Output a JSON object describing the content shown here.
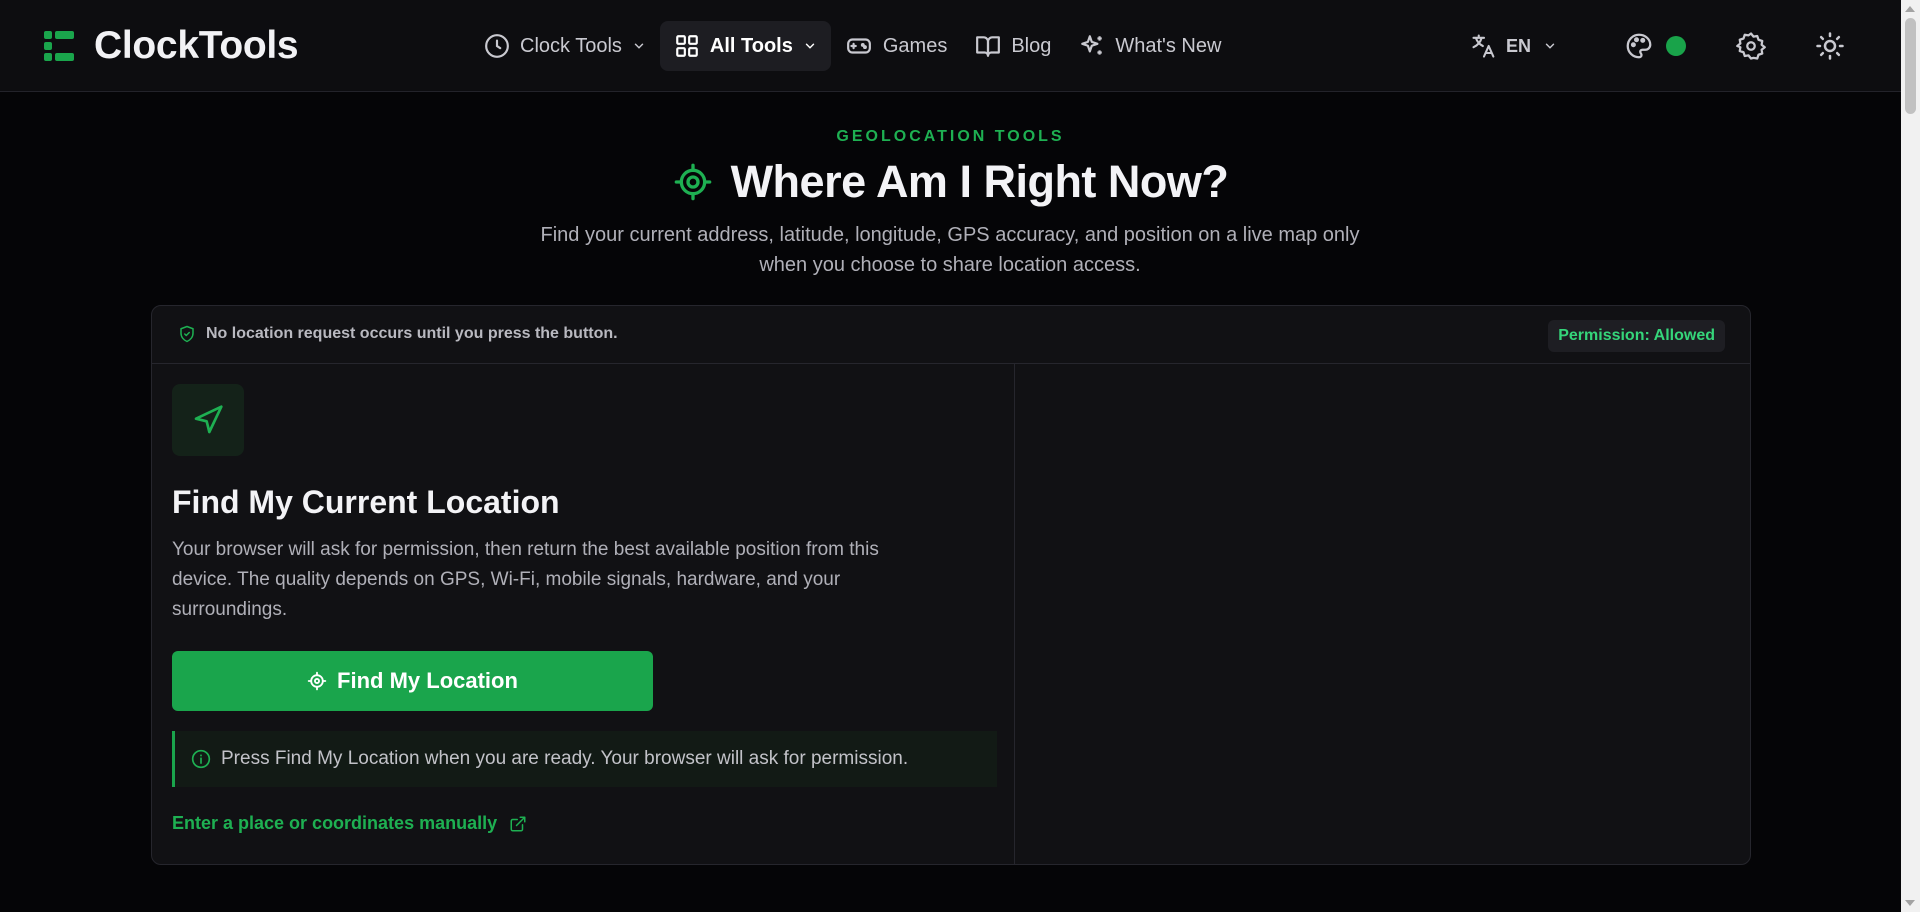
{
  "header": {
    "brand": "ClockTools",
    "nav": [
      {
        "label": "Clock Tools",
        "icon": "clock-icon",
        "has_dropdown": true,
        "active": false
      },
      {
        "label": "All Tools",
        "icon": "grid-icon",
        "has_dropdown": true,
        "active": true
      },
      {
        "label": "Games",
        "icon": "gamepad-icon",
        "has_dropdown": false,
        "active": false
      },
      {
        "label": "Blog",
        "icon": "book-icon",
        "has_dropdown": false,
        "active": false
      },
      {
        "label": "What's New",
        "icon": "sparkles-icon",
        "has_dropdown": false,
        "active": false
      }
    ],
    "language": "EN"
  },
  "hero": {
    "eyebrow": "GEOLOCATION TOOLS",
    "title": "Where Am I Right Now?",
    "subtitle": "Find your current address, latitude, longitude, GPS accuracy, and position on a live map only when you choose to share location access."
  },
  "card": {
    "notice": "No location request occurs until you press the button.",
    "permission_badge": "Permission: Allowed",
    "title": "Find My Current Location",
    "description": "Your browser will ask for permission, then return the best available position from this device. The quality depends on GPS, Wi-Fi, mobile signals, hardware, and your surroundings.",
    "button_label": "Find My Location",
    "info": "Press Find My Location when you are ready. Your browser will ask for permission.",
    "manual_link": "Enter a place or coordinates manually"
  },
  "colors": {
    "accent": "#1aa54c",
    "background": "#050507",
    "header_bg": "#0d0d10",
    "card_bg": "#111114",
    "badge_text": "#35d57a"
  }
}
